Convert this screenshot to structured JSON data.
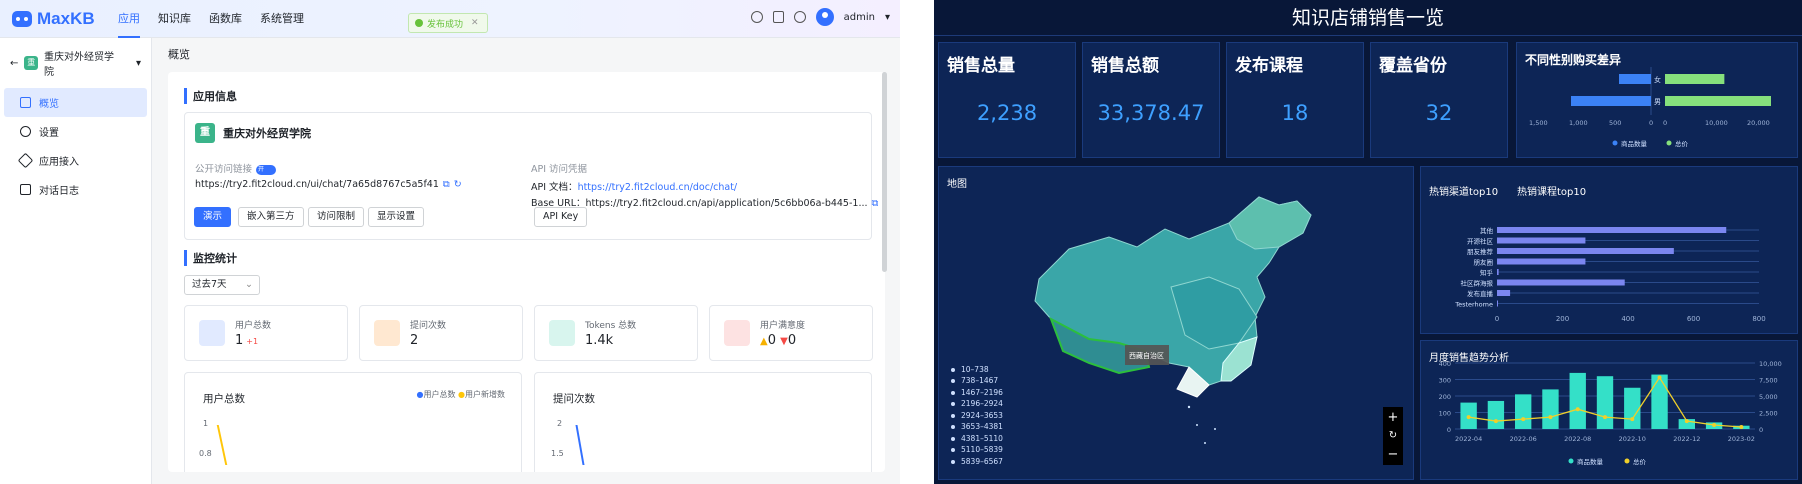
{
  "left": {
    "brand": "MaxKB",
    "nav": [
      "应用",
      "知识库",
      "函数库",
      "系统管理"
    ],
    "toast": "发布成功",
    "user": "admin",
    "app_selector": "重庆对外经贸学院",
    "sidebar": [
      "概览",
      "设置",
      "应用接入",
      "对话日志"
    ],
    "crumb": "概览",
    "section_app": "应用信息",
    "app_name": "重庆对外经贸学院",
    "public_link_label": "公开访问链接",
    "toggle_on": "开",
    "public_link": "https://try2.fit2cloud.cn/ui/chat/7a65d8767c5a5f41",
    "api_label": "API 访问凭据",
    "api_doc_label": "API 文档：",
    "api_doc_link": "https://try2.fit2cloud.cn/doc/chat/",
    "base_url_label": "Base URL：",
    "base_url": "https://try2.fit2cloud.cn/api/application/5c6bb06a-b445-1...",
    "buttons": [
      "演示",
      "嵌入第三方",
      "访问限制",
      "显示设置"
    ],
    "api_key_btn": "API Key",
    "section_monitor": "监控统计",
    "period": "过去7天",
    "stats": [
      {
        "label": "用户总数",
        "value": "1",
        "delta": "+1"
      },
      {
        "label": "提问次数",
        "value": "2",
        "delta": ""
      },
      {
        "label": "Tokens 总数",
        "value": "1.4k",
        "delta": ""
      },
      {
        "label": "用户满意度",
        "value": "0",
        "delta": "0"
      }
    ],
    "chart1_title": "用户总数",
    "chart1_legend": [
      "用户总数",
      "用户新增数"
    ],
    "chart1_ticks": [
      "1",
      "0.8"
    ],
    "chart2_title": "提问次数",
    "chart2_ticks": [
      "2",
      "1.5"
    ]
  },
  "right": {
    "title": "知识店铺销售一览",
    "kpis": [
      {
        "label": "销售总量",
        "value": "2,238"
      },
      {
        "label": "销售总额",
        "value": "33,378.47"
      },
      {
        "label": "发布课程",
        "value": "18"
      },
      {
        "label": "覆盖省份",
        "value": "32"
      }
    ],
    "map_title": "地图",
    "map_tooltip": "西藏自治区",
    "map_legend": [
      "10–738",
      "738–1467",
      "1467–2196",
      "2196–2924",
      "2924–3653",
      "3653–4381",
      "4381–5110",
      "5110–5839",
      "5839–6567"
    ],
    "tab1": "热销渠道top10",
    "tab2": "热销课程top10",
    "monthly_title": "月度销售趋势分析",
    "gender_title": "不同性别购买差异"
  },
  "colors": {
    "accent": "#3370ff",
    "kpi": "#3ea0ff",
    "bar_blue": "#3b82f6",
    "bar_green": "#86e07c",
    "teal": "#34e0c8",
    "yellow": "#f0d02a"
  },
  "chart_data": [
    {
      "type": "bar",
      "title": "不同性别购买差异",
      "categories": [
        "女",
        "男"
      ],
      "series": [
        {
          "name": "商品数量",
          "values": [
            400,
            1000
          ]
        },
        {
          "name": "总价",
          "values": [
            14000,
            25000
          ]
        }
      ],
      "left_ticks": [
        "1,500",
        "1,000",
        "500",
        "0"
      ],
      "right_ticks": [
        "0",
        "10,000",
        "20,000"
      ]
    },
    {
      "type": "bar",
      "title": "热销渠道top10",
      "categories": [
        "其他",
        "开源社区",
        "朋友推荐",
        "朋友圈",
        "知乎",
        "社区群海报",
        "发布直播",
        "Testerhome"
      ],
      "values": [
        700,
        270,
        540,
        270,
        5,
        390,
        40,
        0
      ],
      "xlim": [
        0,
        800
      ],
      "ticks": [
        "0",
        "200",
        "400",
        "600",
        "800"
      ]
    },
    {
      "type": "bar",
      "title": "月度销售趋势分析",
      "categories": [
        "2022-04",
        "2022-05",
        "2022-06",
        "2022-07",
        "2022-08",
        "2022-09",
        "2022-10",
        "2022-11",
        "2022-12",
        "2023-01",
        "2023-02"
      ],
      "series": [
        {
          "name": "商品数量",
          "values": [
            160,
            170,
            210,
            240,
            340,
            320,
            250,
            330,
            60,
            40,
            20
          ]
        },
        {
          "name": "总价",
          "values": [
            1800,
            1200,
            1500,
            1800,
            3000,
            1800,
            1500,
            7800,
            1200,
            600,
            300
          ]
        }
      ],
      "x_ticks": [
        "2022-04",
        "2022-06",
        "2022-08",
        "2022-10",
        "2022-12",
        "2023-02"
      ],
      "left_ticks": [
        "400",
        "300",
        "200",
        "100",
        "0"
      ],
      "right_ticks": [
        "10,000",
        "7,500",
        "5,000",
        "2,500",
        "0"
      ]
    }
  ]
}
